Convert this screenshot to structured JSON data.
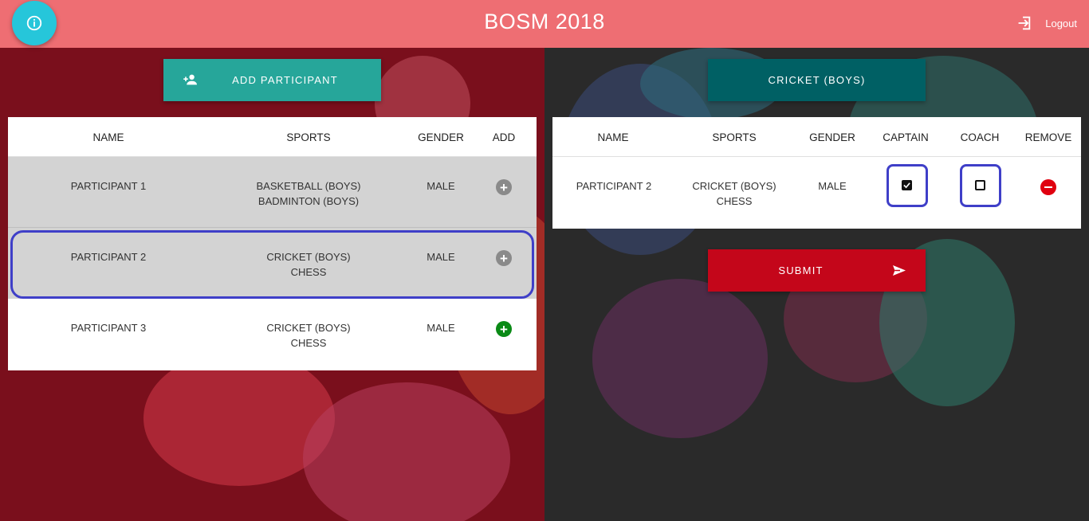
{
  "header": {
    "title": "BOSM 2018",
    "logout_label": "Logout"
  },
  "left": {
    "add_button_label": "ADD PARTICIPANT",
    "columns": [
      "NAME",
      "SPORTS",
      "GENDER",
      "ADD"
    ],
    "rows": [
      {
        "name": "PARTICIPANT 1",
        "sport1": "BASKETBALL (BOYS)",
        "sport2": "BADMINTON (BOYS)",
        "gender": "MALE",
        "add": "+"
      },
      {
        "name": "PARTICIPANT 2",
        "sport1": "CRICKET (BOYS)",
        "sport2": "CHESS",
        "gender": "MALE",
        "add": "+"
      },
      {
        "name": "PARTICIPANT 3",
        "sport1": "CRICKET (BOYS)",
        "sport2": "CHESS",
        "gender": "MALE",
        "add": "+"
      }
    ]
  },
  "right": {
    "sport_button_label": "CRICKET (BOYS)",
    "columns": [
      "NAME",
      "SPORTS",
      "GENDER",
      "CAPTAIN",
      "COACH",
      "REMOVE"
    ],
    "rows": [
      {
        "name": "PARTICIPANT 2",
        "sport1": "CRICKET (BOYS)",
        "sport2": "CHESS",
        "gender": "MALE",
        "captain": true,
        "coach": false
      }
    ],
    "submit_label": "SUBMIT"
  },
  "colors": {
    "header": "#ee6e73",
    "info_button": "#26c6da",
    "add_button": "#26a69a",
    "sport_button": "#006064",
    "submit_button": "#c4061a",
    "add_active": "#0a8a16",
    "add_disabled": "#8a8a8a",
    "remove": "#e0000f",
    "highlight": "#3f3fc8"
  },
  "icons": [
    "info-icon",
    "logout-icon",
    "person-add-icon",
    "send-icon",
    "plus-icon",
    "remove-icon",
    "check-icon"
  ]
}
